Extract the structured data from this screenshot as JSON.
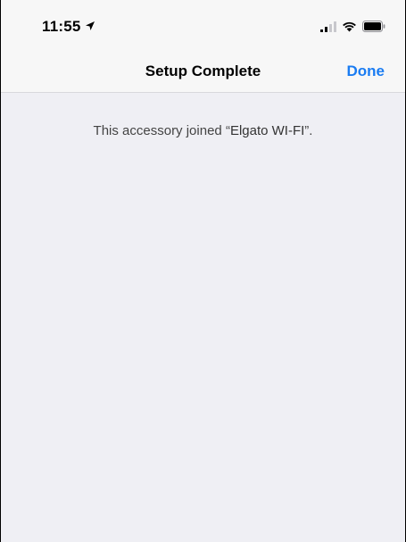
{
  "status_bar": {
    "time": "11:55",
    "location_icon": "location-arrow-icon",
    "signal_icon": "cellular-signal-icon",
    "wifi_icon": "wifi-icon",
    "battery_icon": "battery-icon"
  },
  "nav": {
    "title": "Setup Complete",
    "done_label": "Done"
  },
  "content": {
    "message_prefix": "This accessory joined",
    "open_quote": "“",
    "network_name": "Elgato WI-FI",
    "close_quote": "”."
  },
  "colors": {
    "accent": "#1a7cf2",
    "background": "#efeff4",
    "bar": "#f7f7f7"
  }
}
